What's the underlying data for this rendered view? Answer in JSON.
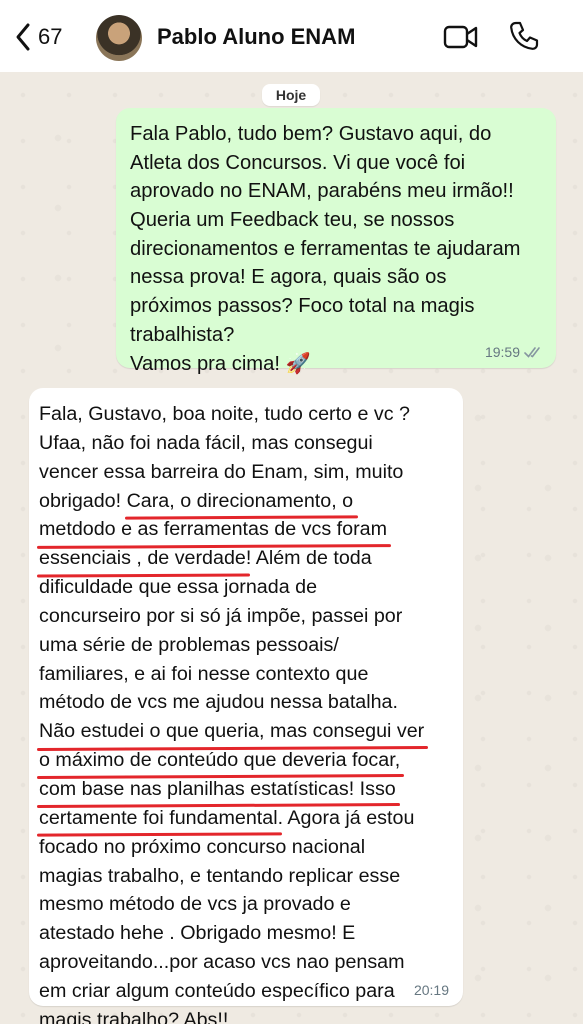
{
  "header": {
    "back_count": "67",
    "contact_name": "Pablo Aluno ENAM"
  },
  "chat": {
    "date_label": "Hoje",
    "outgoing": {
      "lines": [
        "Fala Pablo, tudo bem? Gustavo aqui, do",
        "Atleta dos Concursos. Vi que você foi",
        "aprovado no ENAM, parabéns meu irmão!!",
        "Queria um Feedback teu, se nossos",
        "direcionamentos e ferramentas te ajudaram",
        "nessa prova! E agora, quais são os",
        "próximos passos? Foco total na magis",
        "trabalhista?",
        "Vamos pra cima! 🚀"
      ],
      "time": "19:59",
      "status": "read"
    },
    "incoming": {
      "lines": [
        {
          "pre": "Fala, Gustavo, boa noite, tudo certo e vc ?",
          "u": "",
          "post": ""
        },
        {
          "pre": "Ufaa, não foi nada fácil, mas consegui",
          "u": "",
          "post": ""
        },
        {
          "pre": "vencer essa barreira do Enam, sim, muito",
          "u": "",
          "post": ""
        },
        {
          "pre": "obrigado! ",
          "u": "Cara, o direcionamento, o",
          "post": ""
        },
        {
          "pre": "",
          "u": "metdodo e as ferramentas de vcs foram",
          "post": ""
        },
        {
          "pre": "",
          "u": "essenciais , de verdade",
          "post": "! Além de toda"
        },
        {
          "pre": "dificuldade que essa jornada de",
          "u": "",
          "post": ""
        },
        {
          "pre": "concurseiro por si só já impõe, passei por",
          "u": "",
          "post": ""
        },
        {
          "pre": "uma série de problemas pessoais/",
          "u": "",
          "post": ""
        },
        {
          "pre": "familiares, e ai foi nesse contexto que",
          "u": "",
          "post": ""
        },
        {
          "pre": "método de vcs me ajudou nessa batalha.",
          "u": "",
          "post": ""
        },
        {
          "pre": "",
          "u": "Não estudei o que queria, mas consegui ver",
          "post": ""
        },
        {
          "pre": "",
          "u": "o máximo de conteúdo que deveria focar,",
          "post": ""
        },
        {
          "pre": "",
          "u": "com base nas planilhas estatísticas! Isso",
          "post": ""
        },
        {
          "pre": "",
          "u": "certamente foi fundamental",
          "post": ". Agora já estou"
        },
        {
          "pre": "focado no próximo concurso nacional",
          "u": "",
          "post": ""
        },
        {
          "pre": "magias trabalho, e tentando replicar esse",
          "u": "",
          "post": ""
        },
        {
          "pre": "mesmo método de vcs ja provado e",
          "u": "",
          "post": ""
        },
        {
          "pre": "atestado hehe . Obrigado mesmo! E",
          "u": "",
          "post": ""
        },
        {
          "pre": "aproveitando...por acaso vcs nao pensam",
          "u": "",
          "post": ""
        },
        {
          "pre": "em criar algum conteúdo específico para",
          "u": "",
          "post": ""
        },
        {
          "pre": "magis trabalho? Abs!!",
          "u": "",
          "post": ""
        }
      ],
      "time": "20:19"
    }
  },
  "icons": {
    "back": "chevron-left-icon",
    "video": "video-camera-icon",
    "call": "phone-icon",
    "read": "double-check-icon"
  },
  "colors": {
    "outgoing_bubble": "#d9fdd3",
    "incoming_bubble": "#ffffff",
    "chat_background": "#efeae2",
    "underline": "#e3262b"
  }
}
